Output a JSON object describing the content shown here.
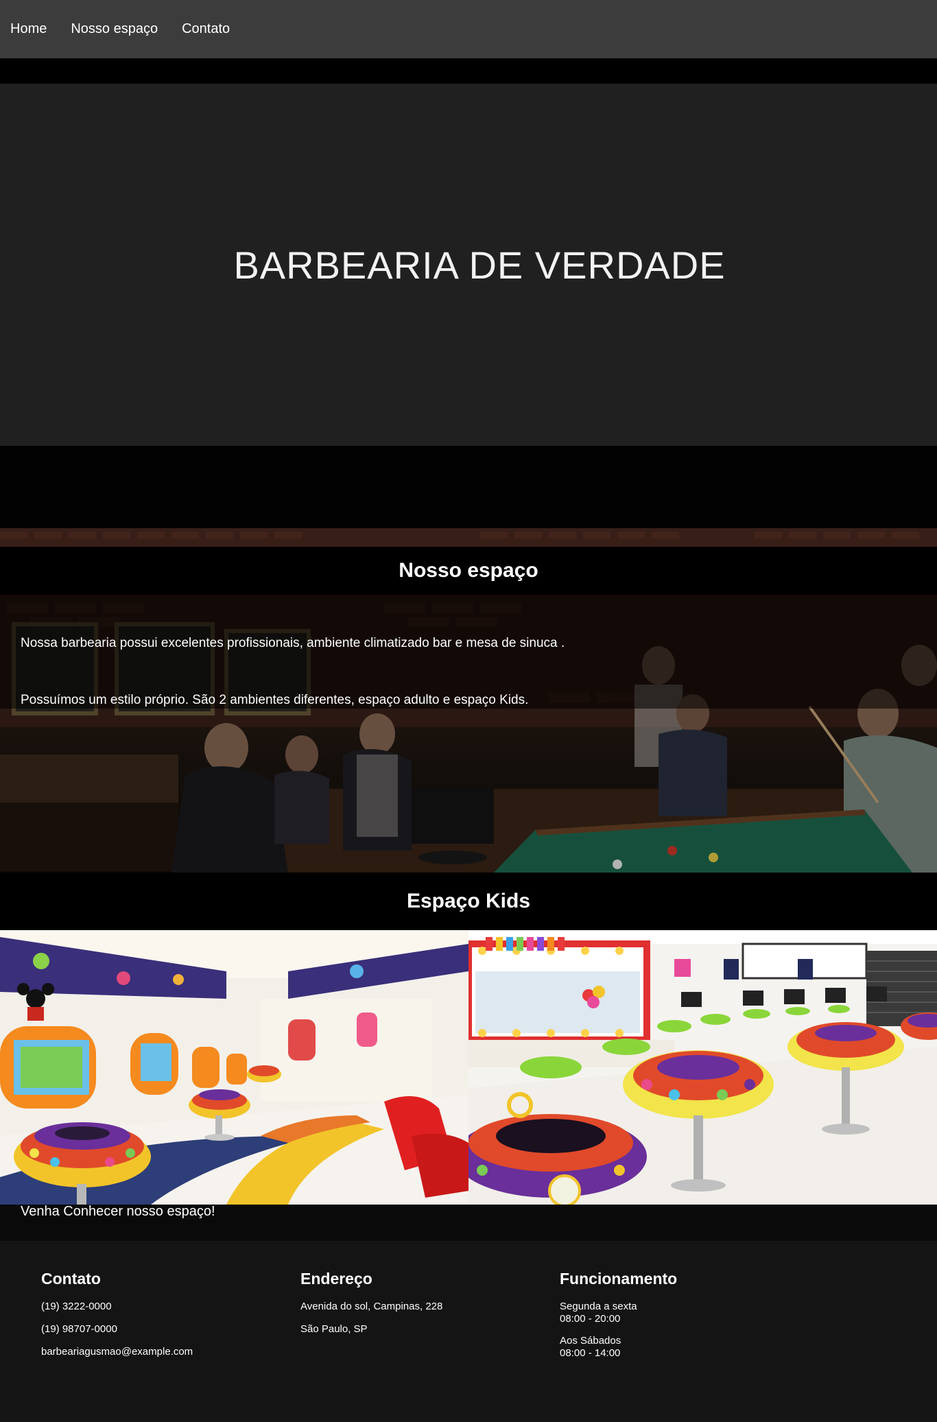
{
  "nav": {
    "items": [
      {
        "label": "Home"
      },
      {
        "label": "Nosso espaço"
      },
      {
        "label": "Contato"
      }
    ]
  },
  "hero": {
    "title": "BARBEARIA DE VERDADE"
  },
  "space": {
    "title": "Nosso espaço",
    "paragraph1": "Nossa barbearia possui excelentes profissionais, ambiente climatizado bar e mesa de sinuca .",
    "paragraph2": "Possuímos um estilo próprio. São 2 ambientes diferentes, espaço adulto e espaço Kids."
  },
  "kids": {
    "title": "Espaço Kids",
    "cta": "Venha Conhecer nosso espaço!"
  },
  "footer": {
    "contact": {
      "title": "Contato",
      "phone1": "(19) 3222-0000",
      "phone2": "(19) 98707-0000",
      "email": "barbeariagusmao@example.com"
    },
    "address": {
      "title": "Endereço",
      "line1": "Avenida do sol, Campinas, 228",
      "line2": "São Paulo, SP"
    },
    "hours": {
      "title": "Funcionamento",
      "weekday_label": "Segunda a sexta",
      "weekday_hours": "08:00 - 20:00",
      "saturday_label": "Aos Sábados",
      "saturday_hours": "08:00 - 14:00"
    }
  },
  "colors": {
    "nav_bg": "#3c3c3c",
    "hero_bg": "#202020",
    "footer_bg": "#141414"
  }
}
